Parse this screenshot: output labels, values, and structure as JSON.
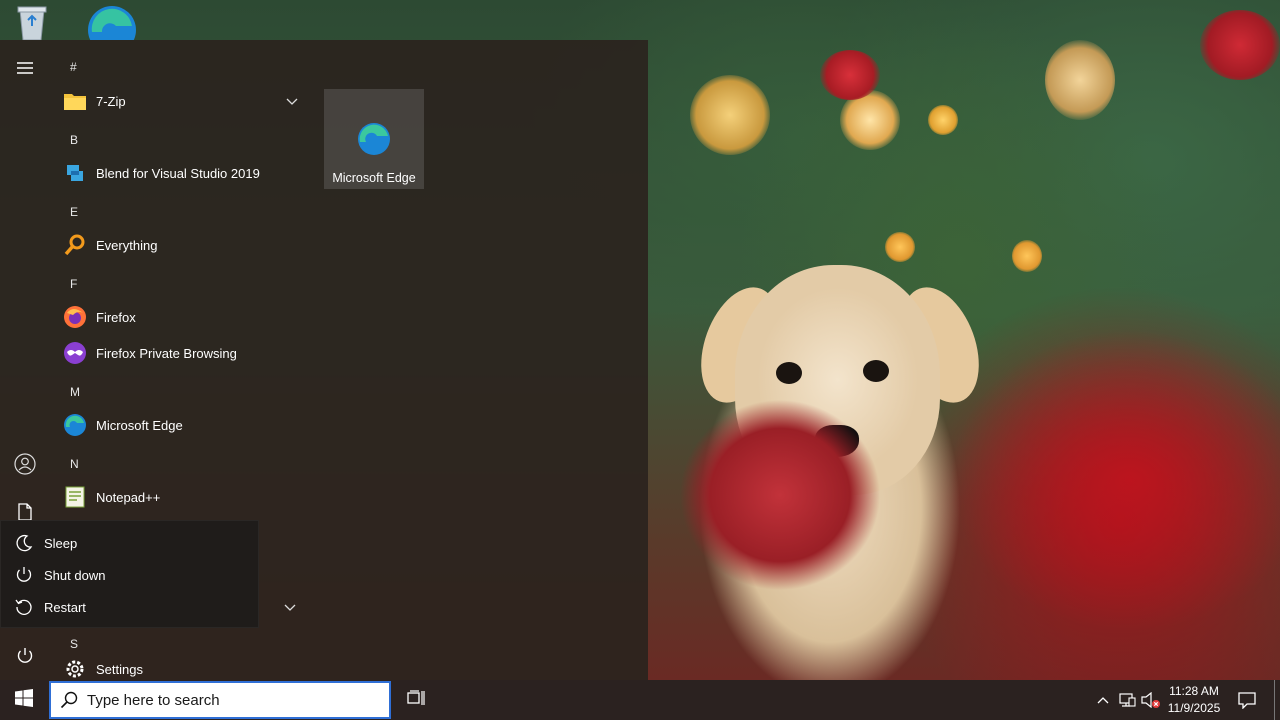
{
  "desktop": {
    "icons": [
      {
        "name": "Recycle Bin",
        "icon": "recycle-bin-icon"
      },
      {
        "name": "Microsoft Edge",
        "icon": "edge-icon"
      }
    ]
  },
  "start_menu": {
    "rail": {
      "hamburger_icon": "hamburger-icon",
      "user_icon": "user-icon",
      "documents_icon": "document-icon",
      "power_icon": "power-icon"
    },
    "letters": {
      "hash": "#",
      "b": "B",
      "e": "E",
      "f": "F",
      "m": "M",
      "n": "N",
      "s": "S"
    },
    "apps": {
      "seven_zip": "7-Zip",
      "blend": "Blend for Visual Studio 2019",
      "everything": "Everything",
      "firefox": "Firefox",
      "firefox_private": "Firefox Private Browsing",
      "edge": "Microsoft Edge",
      "notepadpp": "Notepad++",
      "settings": "Settings"
    },
    "tiles": {
      "edge_tile_label": "Microsoft Edge"
    },
    "power_menu": {
      "sleep": "Sleep",
      "shut_down": "Shut down",
      "restart": "Restart"
    }
  },
  "taskbar": {
    "search_placeholder": "Type here to search",
    "clock_time": "11:28 AM",
    "clock_date": "11/9/2025",
    "icons": [
      "start-icon",
      "search-icon",
      "task-view-icon",
      "chevron-up-icon",
      "network-icon",
      "volume-muted-icon",
      "notification-icon"
    ]
  },
  "colors": {
    "accent": "#2f6fd6",
    "start_menu_bg": "#2b241e",
    "taskbar_bg": "#2b2220"
  }
}
